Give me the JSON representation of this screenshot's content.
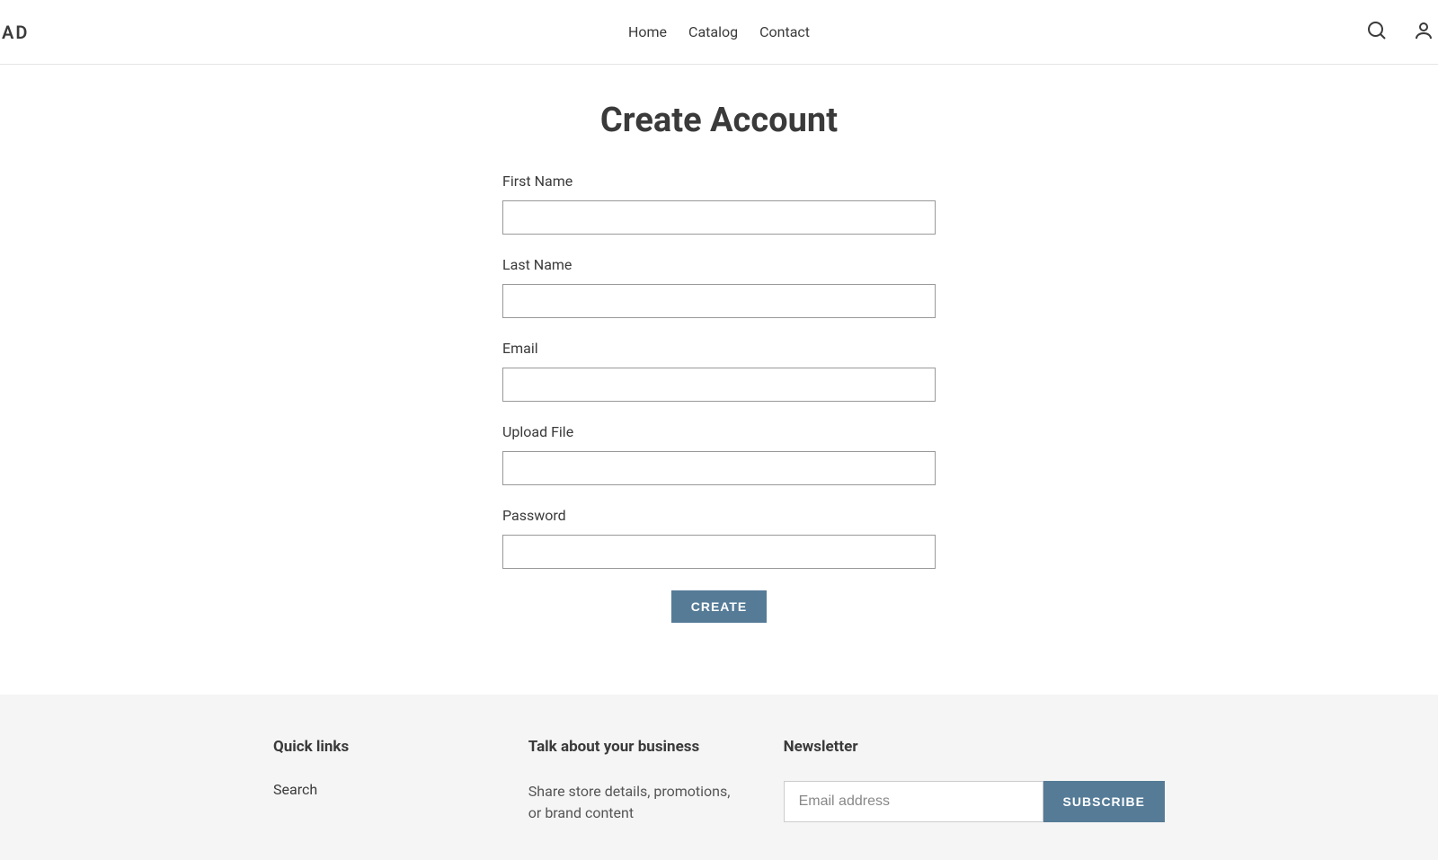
{
  "header": {
    "logo": "AD",
    "nav": {
      "home": "Home",
      "catalog": "Catalog",
      "contact": "Contact"
    }
  },
  "page": {
    "title": "Create Account"
  },
  "form": {
    "first_name_label": "First Name",
    "last_name_label": "Last Name",
    "email_label": "Email",
    "upload_file_label": "Upload File",
    "password_label": "Password",
    "submit_label": "CREATE"
  },
  "footer": {
    "quicklinks": {
      "heading": "Quick links",
      "search": "Search"
    },
    "about": {
      "heading": "Talk about your business",
      "text": "Share store details, promotions, or brand content"
    },
    "newsletter": {
      "heading": "Newsletter",
      "placeholder": "Email address",
      "button": "SUBSCRIBE"
    }
  }
}
